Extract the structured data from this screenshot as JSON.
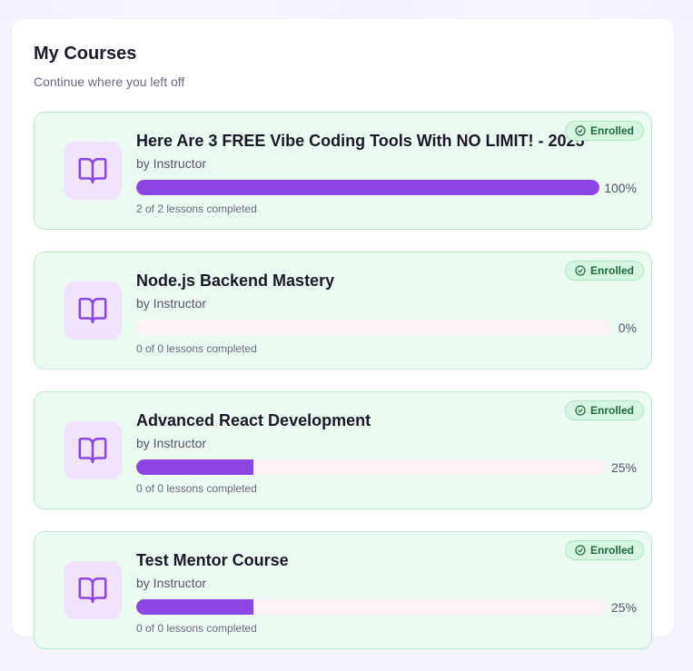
{
  "header": {
    "title": "My Courses",
    "subtitle": "Continue where you left off"
  },
  "colors": {
    "accent": "#8b45e4",
    "card_bg": "#ecfbf1",
    "badge_text": "#1d6b3d"
  },
  "courses": [
    {
      "title": "Here Are 3 FREE Vibe Coding Tools With NO LIMIT! - 2025",
      "instructor": "by Instructor",
      "progress": 100,
      "progress_label": "100%",
      "lessons": "2 of 2 lessons completed",
      "badge": "Enrolled",
      "icon": "book-open-icon"
    },
    {
      "title": "Node.js Backend Mastery",
      "instructor": "by Instructor",
      "progress": 0,
      "progress_label": "0%",
      "lessons": "0 of 0 lessons completed",
      "badge": "Enrolled",
      "icon": "book-open-icon"
    },
    {
      "title": "Advanced React Development",
      "instructor": "by Instructor",
      "progress": 25,
      "progress_label": "25%",
      "lessons": "0 of 0 lessons completed",
      "badge": "Enrolled",
      "icon": "book-open-icon"
    },
    {
      "title": "Test Mentor Course",
      "instructor": "by Instructor",
      "progress": 25,
      "progress_label": "25%",
      "lessons": "0 of 0 lessons completed",
      "badge": "Enrolled",
      "icon": "book-open-icon"
    }
  ]
}
